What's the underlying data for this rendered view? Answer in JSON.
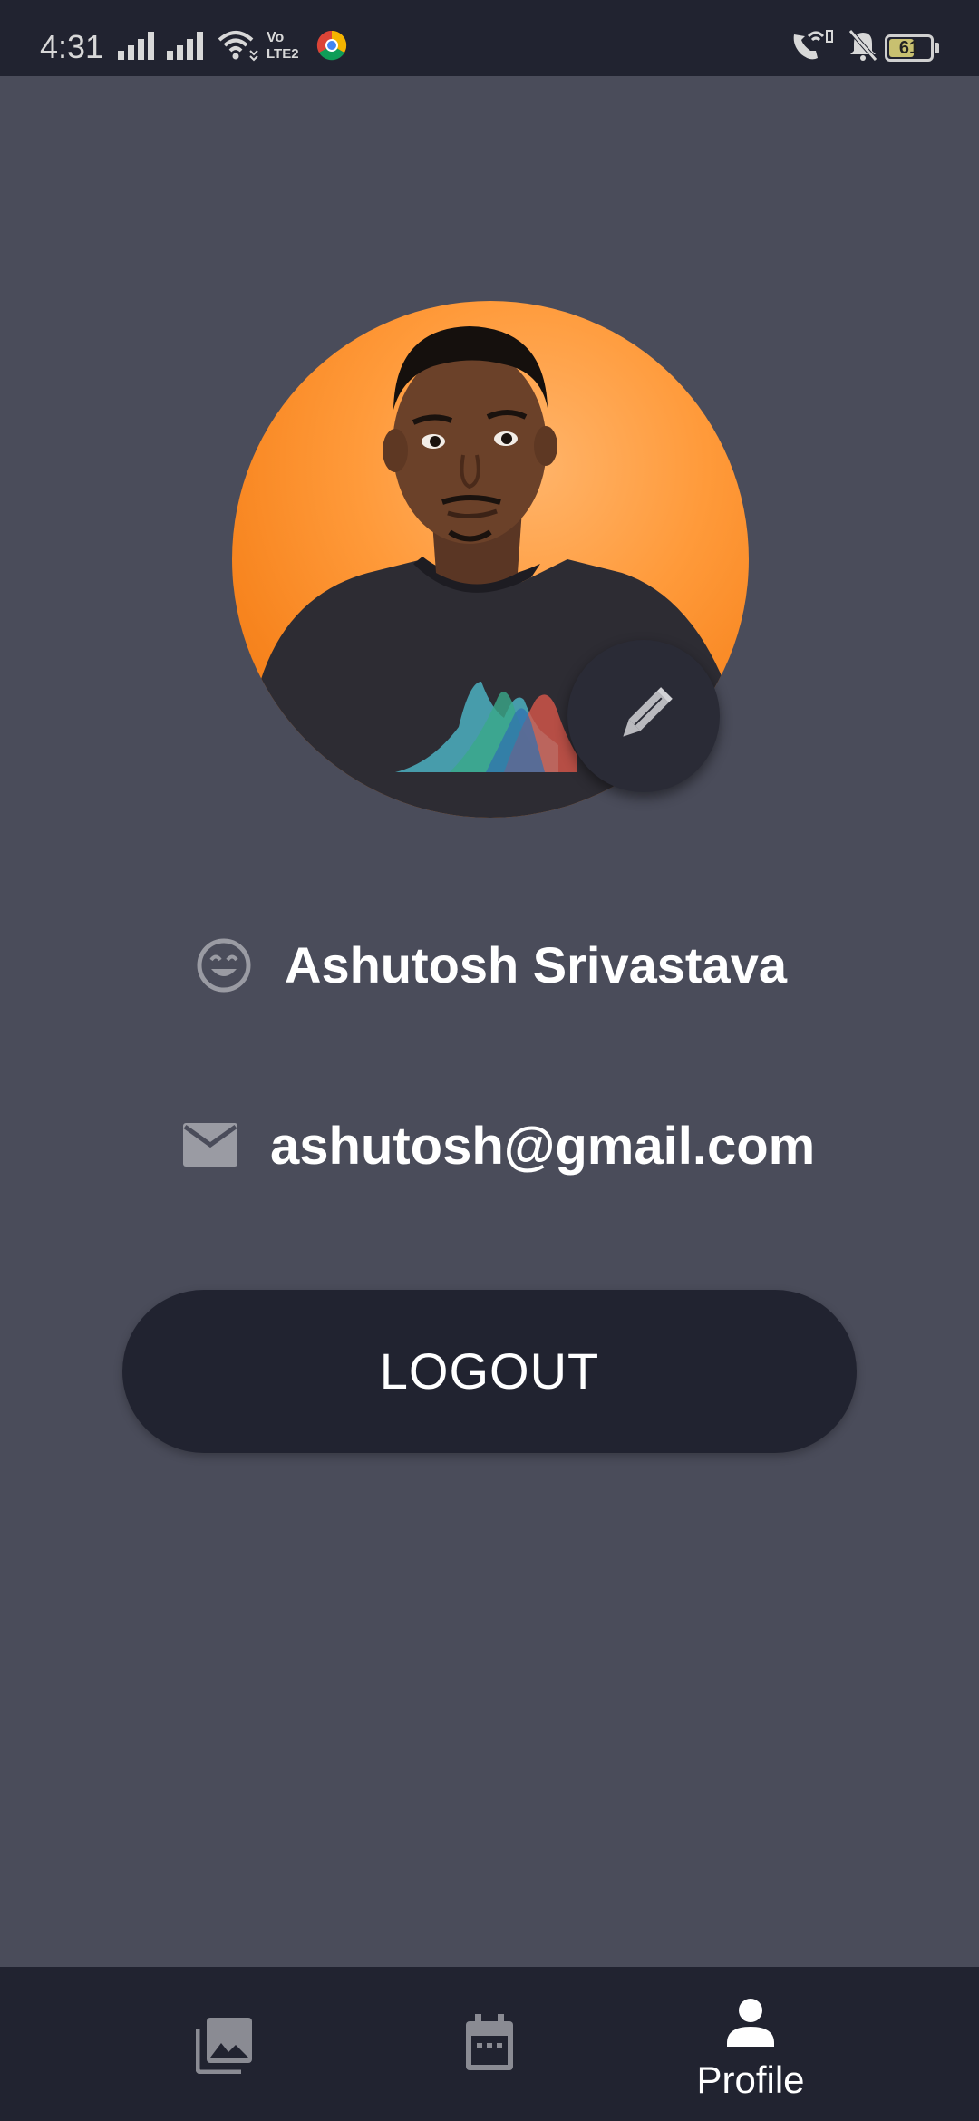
{
  "status_bar": {
    "time": "4:31",
    "battery_level": "61",
    "battery_percent": 0.61
  },
  "profile": {
    "name": "Ashutosh Srivastava",
    "email": "ashutosh@gmail.com"
  },
  "actions": {
    "logout_label": "LOGOUT"
  },
  "bottom_nav": {
    "items": [
      {
        "icon": "gallery-icon",
        "label": "",
        "active": false
      },
      {
        "icon": "calendar-icon",
        "label": "",
        "active": false
      },
      {
        "icon": "person-icon",
        "label": "Profile",
        "active": true
      }
    ]
  },
  "colors": {
    "background": "#4a4c5a",
    "surface_dark": "#212330",
    "avatar_orange": "#ff9a3a",
    "text_primary": "#ffffff",
    "icon_muted": "#9a9ba3"
  }
}
